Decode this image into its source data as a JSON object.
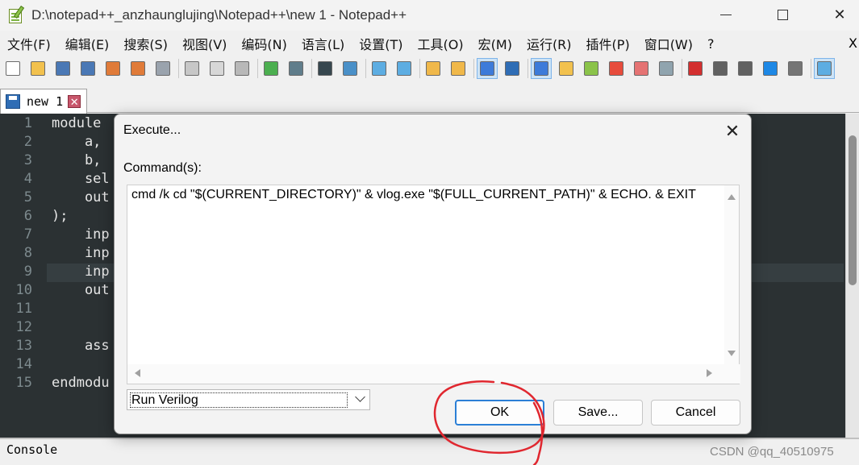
{
  "window": {
    "title": "D:\\notepad++_anzhaunglujing\\Notepad++\\new 1 - Notepad++",
    "minimize_glyph": "",
    "maximize_glyph": "",
    "close_glyph": "✕"
  },
  "menu": {
    "items": [
      "文件(F)",
      "编辑(E)",
      "搜索(S)",
      "视图(V)",
      "编码(N)",
      "语言(L)",
      "设置(T)",
      "工具(O)",
      "宏(M)",
      "运行(R)",
      "插件(P)",
      "窗口(W)",
      "?"
    ],
    "close_label": "X"
  },
  "toolbar": {
    "icons": [
      {
        "name": "new-file-icon",
        "color": "#ffffff"
      },
      {
        "name": "open-file-icon",
        "color": "#f2c14e"
      },
      {
        "name": "save-icon",
        "color": "#4a78b5"
      },
      {
        "name": "save-all-icon",
        "color": "#4a78b5"
      },
      {
        "name": "close-icon",
        "color": "#e07b39"
      },
      {
        "name": "close-all-icon",
        "color": "#e07b39"
      },
      {
        "name": "print-icon",
        "color": "#9aa3ad"
      },
      {
        "sep": true
      },
      {
        "name": "cut-icon",
        "color": "#c7c7c7"
      },
      {
        "name": "copy-icon",
        "color": "#d7d7d7"
      },
      {
        "name": "paste-icon",
        "color": "#b8b8b8"
      },
      {
        "sep": true
      },
      {
        "name": "undo-icon",
        "color": "#4caf50"
      },
      {
        "name": "redo-icon",
        "color": "#607d8b"
      },
      {
        "sep": true
      },
      {
        "name": "find-icon",
        "color": "#37474f"
      },
      {
        "name": "replace-icon",
        "color": "#4a90c8"
      },
      {
        "sep": true
      },
      {
        "name": "zoom-in-icon",
        "color": "#5dade2"
      },
      {
        "name": "zoom-out-icon",
        "color": "#5dade2"
      },
      {
        "sep": true
      },
      {
        "name": "sync-vertical-icon",
        "color": "#f0b84a"
      },
      {
        "name": "sync-horizontal-icon",
        "color": "#f0b84a"
      },
      {
        "sep": true
      },
      {
        "name": "word-wrap-icon",
        "color": "#3d7bd9",
        "active": true
      },
      {
        "name": "show-all-chars-icon",
        "color": "#2f6db5"
      },
      {
        "sep": true
      },
      {
        "name": "indent-guide-icon",
        "color": "#3d7bd9",
        "active": true
      },
      {
        "name": "udl-icon",
        "color": "#f2c14e"
      },
      {
        "name": "doc-map-icon",
        "color": "#8bc34a"
      },
      {
        "name": "function-list-icon",
        "color": "#e74c3c"
      },
      {
        "name": "folder-as-workspace-icon",
        "color": "#e57373"
      },
      {
        "name": "monitoring-icon",
        "color": "#90a4ae"
      },
      {
        "sep": true
      },
      {
        "name": "record-macro-icon",
        "color": "#d32f2f"
      },
      {
        "name": "stop-macro-icon",
        "color": "#616161"
      },
      {
        "name": "play-macro-icon",
        "color": "#616161"
      },
      {
        "name": "run-macro-multiple-icon",
        "color": "#1e88e5"
      },
      {
        "name": "save-macro-icon",
        "color": "#757575"
      },
      {
        "sep": true
      },
      {
        "name": "panel-icon",
        "color": "#5dade2",
        "active": true
      }
    ]
  },
  "tab": {
    "label": "new 1",
    "close_glyph": "✕"
  },
  "editor": {
    "line_numbers": [
      "1",
      "2",
      "3",
      "4",
      "5",
      "6",
      "7",
      "8",
      "9",
      "10",
      "11",
      "12",
      "13",
      "14",
      "15"
    ],
    "lines": [
      "module",
      "    a,",
      "    b,",
      "    sel",
      "    out",
      ");",
      "    inp",
      "    inp",
      "    inp",
      "    out",
      "",
      "",
      "    ass",
      "",
      "endmodu"
    ]
  },
  "dialog": {
    "title": "Execute...",
    "close_glyph": "✕",
    "commands_label": "Command(s):",
    "command": "cmd /k cd \"$(CURRENT_DIRECTORY)\" & vlog.exe \"$(FULL_CURRENT_PATH)\" & ECHO. & EXIT",
    "program_name": "Run Verilog",
    "ok_label": "OK",
    "save_label": "Save...",
    "cancel_label": "Cancel"
  },
  "console": {
    "label": "Console"
  },
  "watermark": "CSDN @qq_40510975",
  "colors": {
    "editor_bg": "#2b3133",
    "annotation_red": "#e0272f",
    "ok_border": "#2b7fd6"
  }
}
